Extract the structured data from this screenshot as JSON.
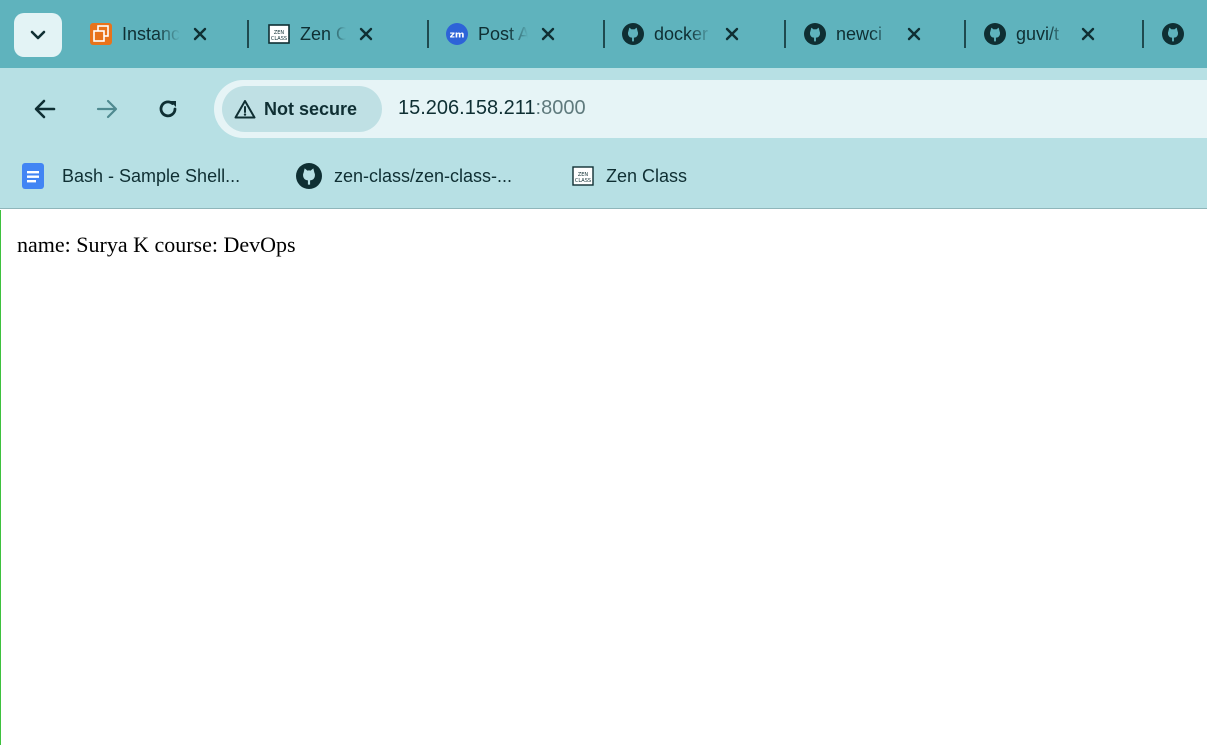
{
  "tabs": [
    {
      "title": "Instances",
      "icon": "aws-instances-icon"
    },
    {
      "title": "Zen Class",
      "icon": "zen-class-icon"
    },
    {
      "title": "Post A",
      "icon": "zm-icon"
    },
    {
      "title": "docker",
      "icon": "github-icon"
    },
    {
      "title": "newci",
      "icon": "github-icon"
    },
    {
      "title": "guvi/t",
      "icon": "github-icon"
    },
    {
      "title": "",
      "icon": "github-icon"
    }
  ],
  "zm_icon_text": "zm",
  "zen_icon_text": "ZEN CLASS",
  "address_bar": {
    "security_label": "Not secure",
    "url_host": "15.206.158.211",
    "url_port": ":8000"
  },
  "bookmarks": [
    {
      "label": "Bash - Sample Shell...",
      "icon": "google-docs-icon"
    },
    {
      "label": "zen-class/zen-class-...",
      "icon": "github-icon"
    },
    {
      "label": "Zen Class",
      "icon": "zen-class-icon"
    }
  ],
  "page": {
    "body_text": "name: Surya K course: DevOps"
  },
  "colors": {
    "tabstrip": "#5fb3bd",
    "toolbar": "#b7e0e4",
    "omnibox": "#e6f4f6",
    "content_border": "#3ec13e"
  }
}
